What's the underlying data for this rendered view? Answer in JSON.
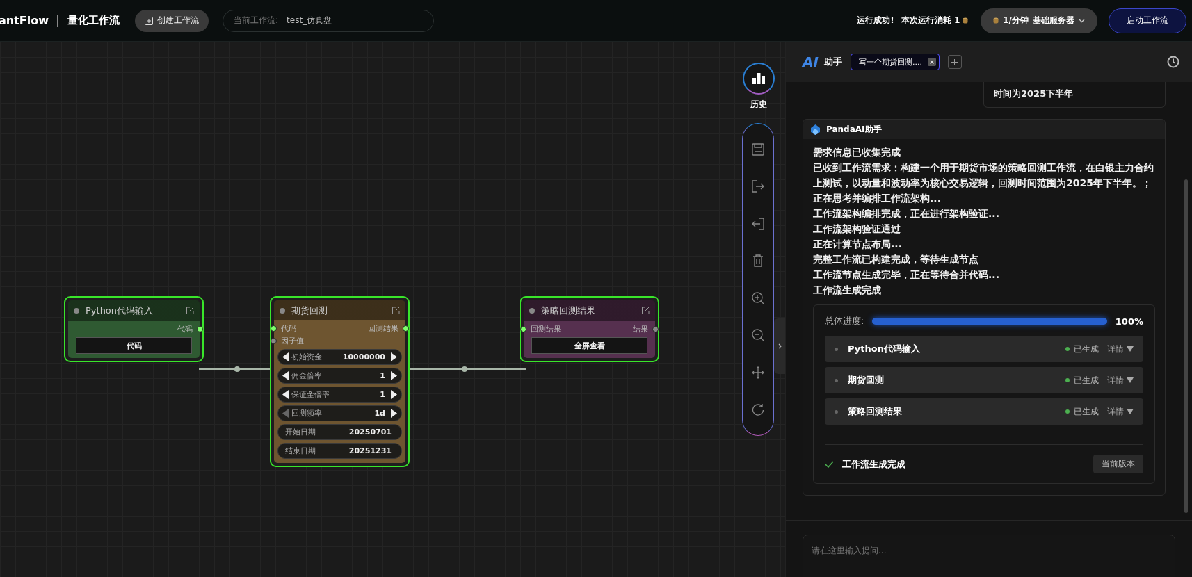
{
  "header": {
    "logo_text": "antFlow",
    "app_title": "量化工作流",
    "create_button": "创建工作流",
    "current_label": "当前工作流:",
    "current_workflow": "test_仿真盘",
    "run_status": "运行成功!",
    "cost": "本次运行消耗 1",
    "plan": "1/分钟",
    "server": "基础服务器",
    "start_button": "启动工作流"
  },
  "toolbar": {
    "history_label": "历史"
  },
  "nodes": [
    {
      "title": "Python代码输入",
      "color": "#2f5a32",
      "outputs": [
        {
          "label": "代码",
          "connected": true
        }
      ],
      "button": "代码"
    },
    {
      "title": "期货回测",
      "color": "#6e5530",
      "inputs": [
        {
          "label": "代码",
          "connected": true
        },
        {
          "label": "因子值",
          "connected": false
        }
      ],
      "outputs": [
        {
          "label": "回测结果",
          "connected": true
        }
      ],
      "params": [
        {
          "kind": "stepper",
          "label": "初始资金",
          "value": "10000000",
          "decrement_disabled": false
        },
        {
          "kind": "stepper",
          "label": "佣金倍率",
          "value": "1",
          "decrement_disabled": false
        },
        {
          "kind": "stepper",
          "label": "保证金倍率",
          "value": "1",
          "decrement_disabled": false
        },
        {
          "kind": "stepper",
          "label": "回测频率",
          "value": "1d",
          "decrement_disabled": true
        },
        {
          "kind": "field",
          "label": "开始日期",
          "value": "20250701"
        },
        {
          "kind": "field",
          "label": "结束日期",
          "value": "20251231"
        }
      ]
    },
    {
      "title": "策略回测结果",
      "color": "#56304f",
      "inputs": [
        {
          "label": "回测结果",
          "connected": true
        }
      ],
      "outputs": [
        {
          "label": "结果",
          "connected": false
        }
      ],
      "button": "全屏查看"
    }
  ],
  "assistant": {
    "logo": "AI",
    "title": "助手",
    "tabs": [
      {
        "label": "写一个期货回测....",
        "selected": true
      }
    ],
    "user_message": "时间为2025下半年",
    "bot_name": "PandaAI助手",
    "lines": [
      "需求信息已收集完成",
      "已收到工作流需求：构建一个用于期货市场的策略回测工作流，在白银主力合约上测试，以动量和波动率为核心交易逻辑，回测时间范围为2025年下半年。；正在思考并编排工作流架构...",
      "工作流架构编排完成，正在进行架构验证...",
      "工作流架构验证通过",
      "正在计算节点布局...",
      "完整工作流已构建完成，等待生成节点",
      "工作流节点生成完毕，正在等待合并代码...",
      "工作流生成完成"
    ],
    "progress": {
      "label": "总体进度:",
      "level": 1,
      "percent": "100%"
    },
    "steps": [
      {
        "name": "Python代码输入",
        "status": "已生成",
        "detail": "详情"
      },
      {
        "name": "期货回测",
        "status": "已生成",
        "detail": "详情"
      },
      {
        "name": "策略回测结果",
        "status": "已生成",
        "detail": "详情"
      }
    ],
    "done_text": "工作流生成完成",
    "version_button": "当前版本",
    "input": {
      "placeholder": "请在这里输入提问..."
    }
  }
}
